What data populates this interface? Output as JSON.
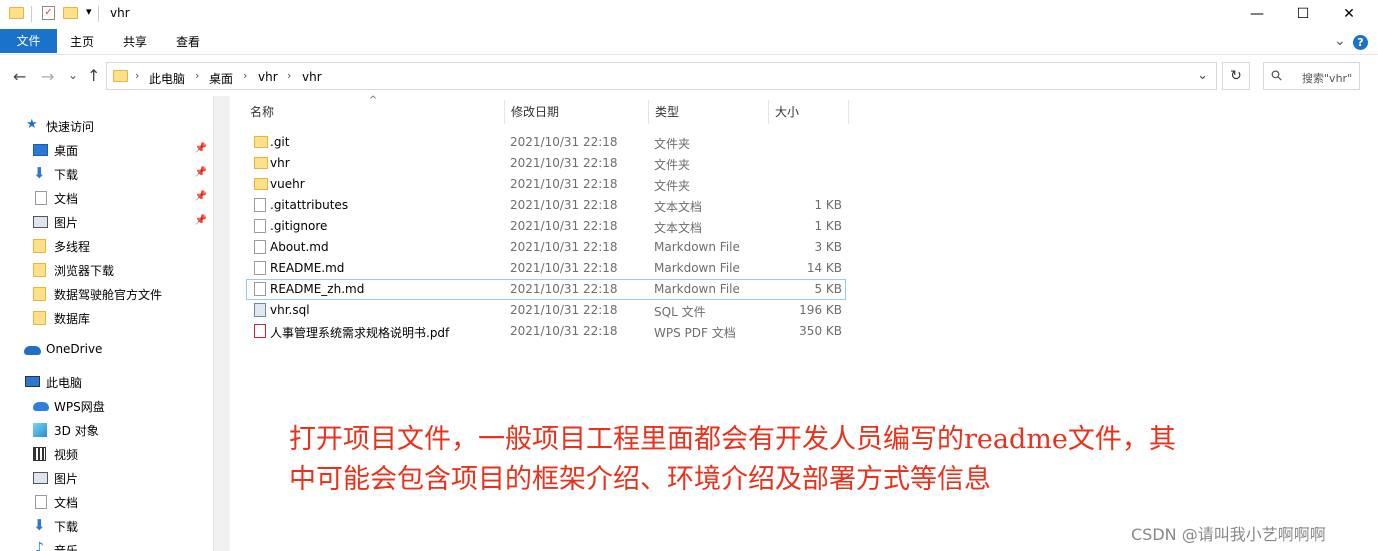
{
  "window": {
    "title": "vhr",
    "minimize_glyph": "—",
    "maximize_glyph": "☐",
    "close_glyph": "✕",
    "quick_access_dropdown_glyph": "▾"
  },
  "ribbon": {
    "tabs": [
      "文件",
      "主页",
      "共享",
      "查看"
    ],
    "collapse_glyph": "⌄",
    "help_glyph": "?"
  },
  "address_bar": {
    "back_glyph": "←",
    "forward_glyph": "→",
    "recent_glyph": "⌄",
    "up_glyph": "↑",
    "crumbs": [
      "此电脑",
      "桌面",
      "vhr",
      "vhr"
    ],
    "separator": "›",
    "dropdown_glyph": "⌄",
    "refresh_glyph": "↻",
    "search_placeholder": "搜索\"vhr\"",
    "search_icon_glyph": "⚲"
  },
  "sidebar": {
    "quick_access": "快速访问",
    "quick_items": [
      "桌面",
      "下载",
      "文档",
      "图片",
      "多线程",
      "浏览器下载",
      "数据驾驶舱官方文件",
      "数据库"
    ],
    "onedrive": "OneDrive",
    "this_pc": "此电脑",
    "pc_items": [
      "WPS网盘",
      "3D 对象",
      "视频",
      "图片",
      "文档",
      "下载",
      "音乐"
    ]
  },
  "columns": {
    "name": "名称",
    "date": "修改日期",
    "type": "类型",
    "size": "大小",
    "sort_glyph": "^"
  },
  "files": [
    {
      "name": ".git",
      "date": "2021/10/31 22:18",
      "type": "文件夹",
      "size": "",
      "icon": "folder"
    },
    {
      "name": "vhr",
      "date": "2021/10/31 22:18",
      "type": "文件夹",
      "size": "",
      "icon": "folder"
    },
    {
      "name": "vuehr",
      "date": "2021/10/31 22:18",
      "type": "文件夹",
      "size": "",
      "icon": "folder"
    },
    {
      "name": ".gitattributes",
      "date": "2021/10/31 22:18",
      "type": "文本文档",
      "size": "1 KB",
      "icon": "doc"
    },
    {
      "name": ".gitignore",
      "date": "2021/10/31 22:18",
      "type": "文本文档",
      "size": "1 KB",
      "icon": "doc"
    },
    {
      "name": "About.md",
      "date": "2021/10/31 22:18",
      "type": "Markdown File",
      "size": "3 KB",
      "icon": "doc"
    },
    {
      "name": "README.md",
      "date": "2021/10/31 22:18",
      "type": "Markdown File",
      "size": "14 KB",
      "icon": "doc"
    },
    {
      "name": "README_zh.md",
      "date": "2021/10/31 22:18",
      "type": "Markdown File",
      "size": "5 KB",
      "icon": "doc"
    },
    {
      "name": "vhr.sql",
      "date": "2021/10/31 22:18",
      "type": "SQL 文件",
      "size": "196 KB",
      "icon": "sql"
    },
    {
      "name": "人事管理系统需求规格说明书.pdf",
      "date": "2021/10/31 22:18",
      "type": "WPS PDF 文档",
      "size": "350 KB",
      "icon": "pdf"
    }
  ],
  "annotation": {
    "line1": "打开项目文件，一般项目工程里面都会有开发人员编写的readme文件，其",
    "line2": "中可能会包含项目的框架介绍、环境介绍及部署方式等信息"
  },
  "watermark": "CSDN @请叫我小艺啊啊啊"
}
